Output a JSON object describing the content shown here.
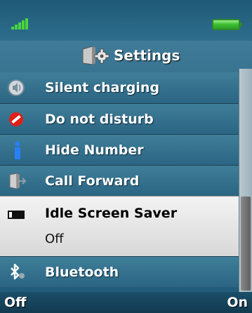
{
  "header": {
    "title": "Settings"
  },
  "menu": {
    "items": [
      {
        "label": "Silent charging",
        "icon": "speaker-icon"
      },
      {
        "label": "Do not disturb",
        "icon": "no-entry-icon"
      },
      {
        "label": "Hide Number",
        "icon": "info-icon"
      },
      {
        "label": "Call Forward",
        "icon": "forward-phone-icon"
      },
      {
        "label": "Idle Screen Saver",
        "value": "Off",
        "icon": "screen-icon",
        "selected": true
      },
      {
        "label": "Bluetooth",
        "icon": "bluetooth-icon"
      }
    ]
  },
  "softkeys": {
    "left": "Off",
    "right": "On"
  },
  "colors": {
    "accent": "#2b6583",
    "selection": "#e6e6e6",
    "signal": "#49d63b",
    "battery": "#3fc233"
  }
}
